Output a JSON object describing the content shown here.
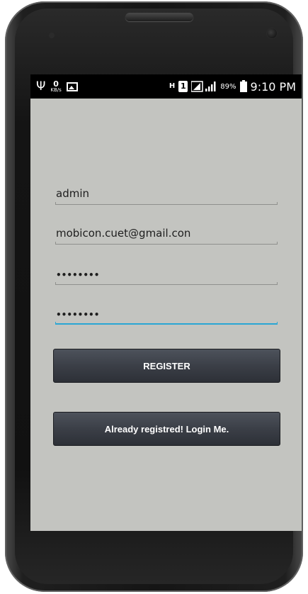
{
  "status_bar": {
    "net_speed_value": "0",
    "net_speed_unit": "KB/s",
    "h_label": "H",
    "sim_label": "1",
    "battery_percent": "89%",
    "time": "9:10 PM"
  },
  "form": {
    "username_value": "admin",
    "email_value": "mobicon.cuet@gmail.con",
    "password_value": "••••••••",
    "confirm_password_value": "••••••••",
    "focus_color": "#2aa6d4"
  },
  "buttons": {
    "register_label": "REGISTER",
    "login_label": "Already registred! Login Me."
  },
  "icons": {
    "usb": "usb-icon",
    "image": "image-icon",
    "signal": "signal-icon",
    "battery": "battery-charging-icon"
  }
}
